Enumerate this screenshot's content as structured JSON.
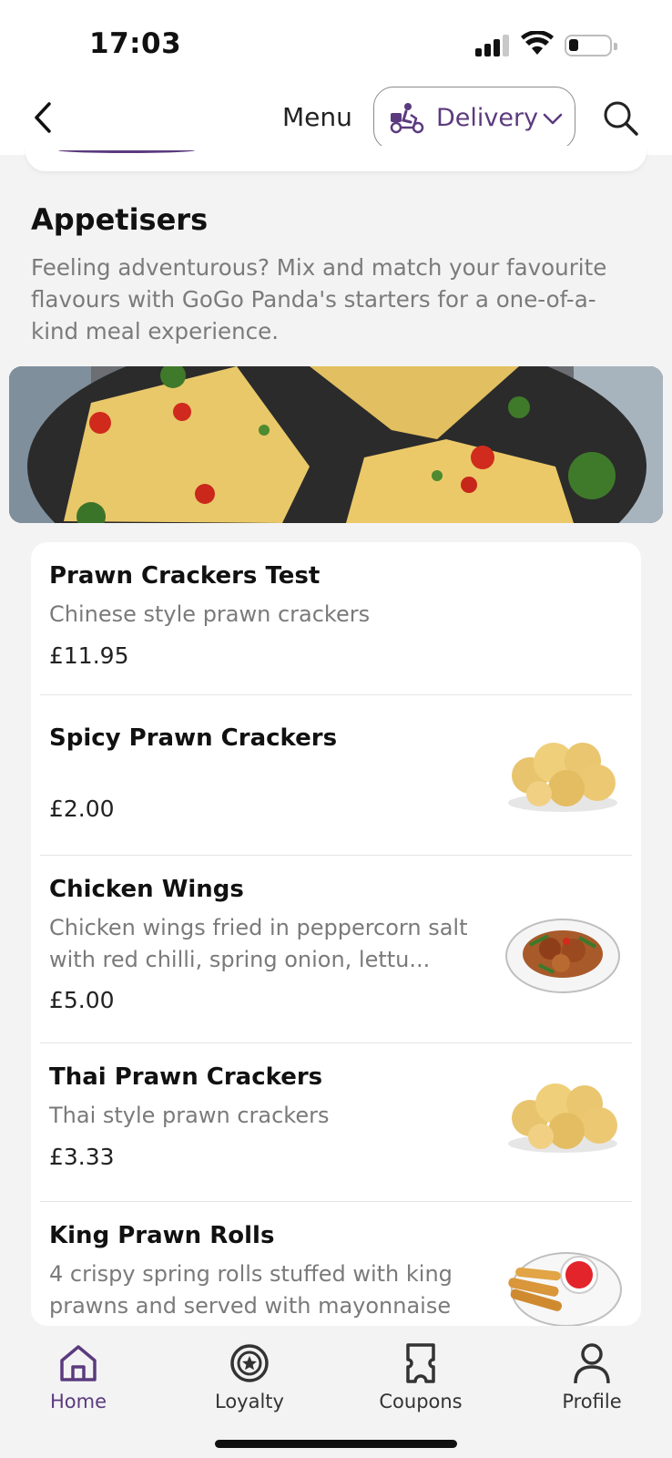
{
  "status_bar": {
    "time": "17:03"
  },
  "header": {
    "title": "Menu",
    "delivery_label": "Delivery"
  },
  "section": {
    "title": "Appetisers",
    "description": "Feeling adventurous? Mix and match your favourite flavours with GoGo Panda's starters for a one-of-a-kind meal experience."
  },
  "items": [
    {
      "name": "Prawn Crackers Test",
      "description": "Chinese style prawn crackers",
      "price": "£11.95",
      "image": "none"
    },
    {
      "name": "Spicy Prawn Crackers",
      "description": "",
      "price": "£2.00",
      "image": "prawn-crackers-photo"
    },
    {
      "name": "Chicken Wings",
      "description": "Chicken wings fried in peppercorn salt with red chilli, spring onion, lettu...",
      "price": "£5.00",
      "image": "chicken-wings-photo"
    },
    {
      "name": "Thai Prawn Crackers",
      "description": "Thai style prawn crackers",
      "price": "£3.33",
      "image": "prawn-crackers-photo"
    },
    {
      "name": "King Prawn Rolls",
      "description": "4 crispy spring rolls stuffed with king prawns and served with mayonnaise",
      "price": "",
      "image": "spring-rolls-photo"
    }
  ],
  "bottom_nav": [
    {
      "label": "Home",
      "icon": "home-icon",
      "active": true
    },
    {
      "label": "Loyalty",
      "icon": "loyalty-icon",
      "active": false
    },
    {
      "label": "Coupons",
      "icon": "coupon-icon",
      "active": false
    },
    {
      "label": "Profile",
      "icon": "profile-icon",
      "active": false
    }
  ],
  "colors": {
    "accent": "#5b3a7e",
    "background": "#f3f3f4",
    "muted_text": "#7b7b7b"
  }
}
